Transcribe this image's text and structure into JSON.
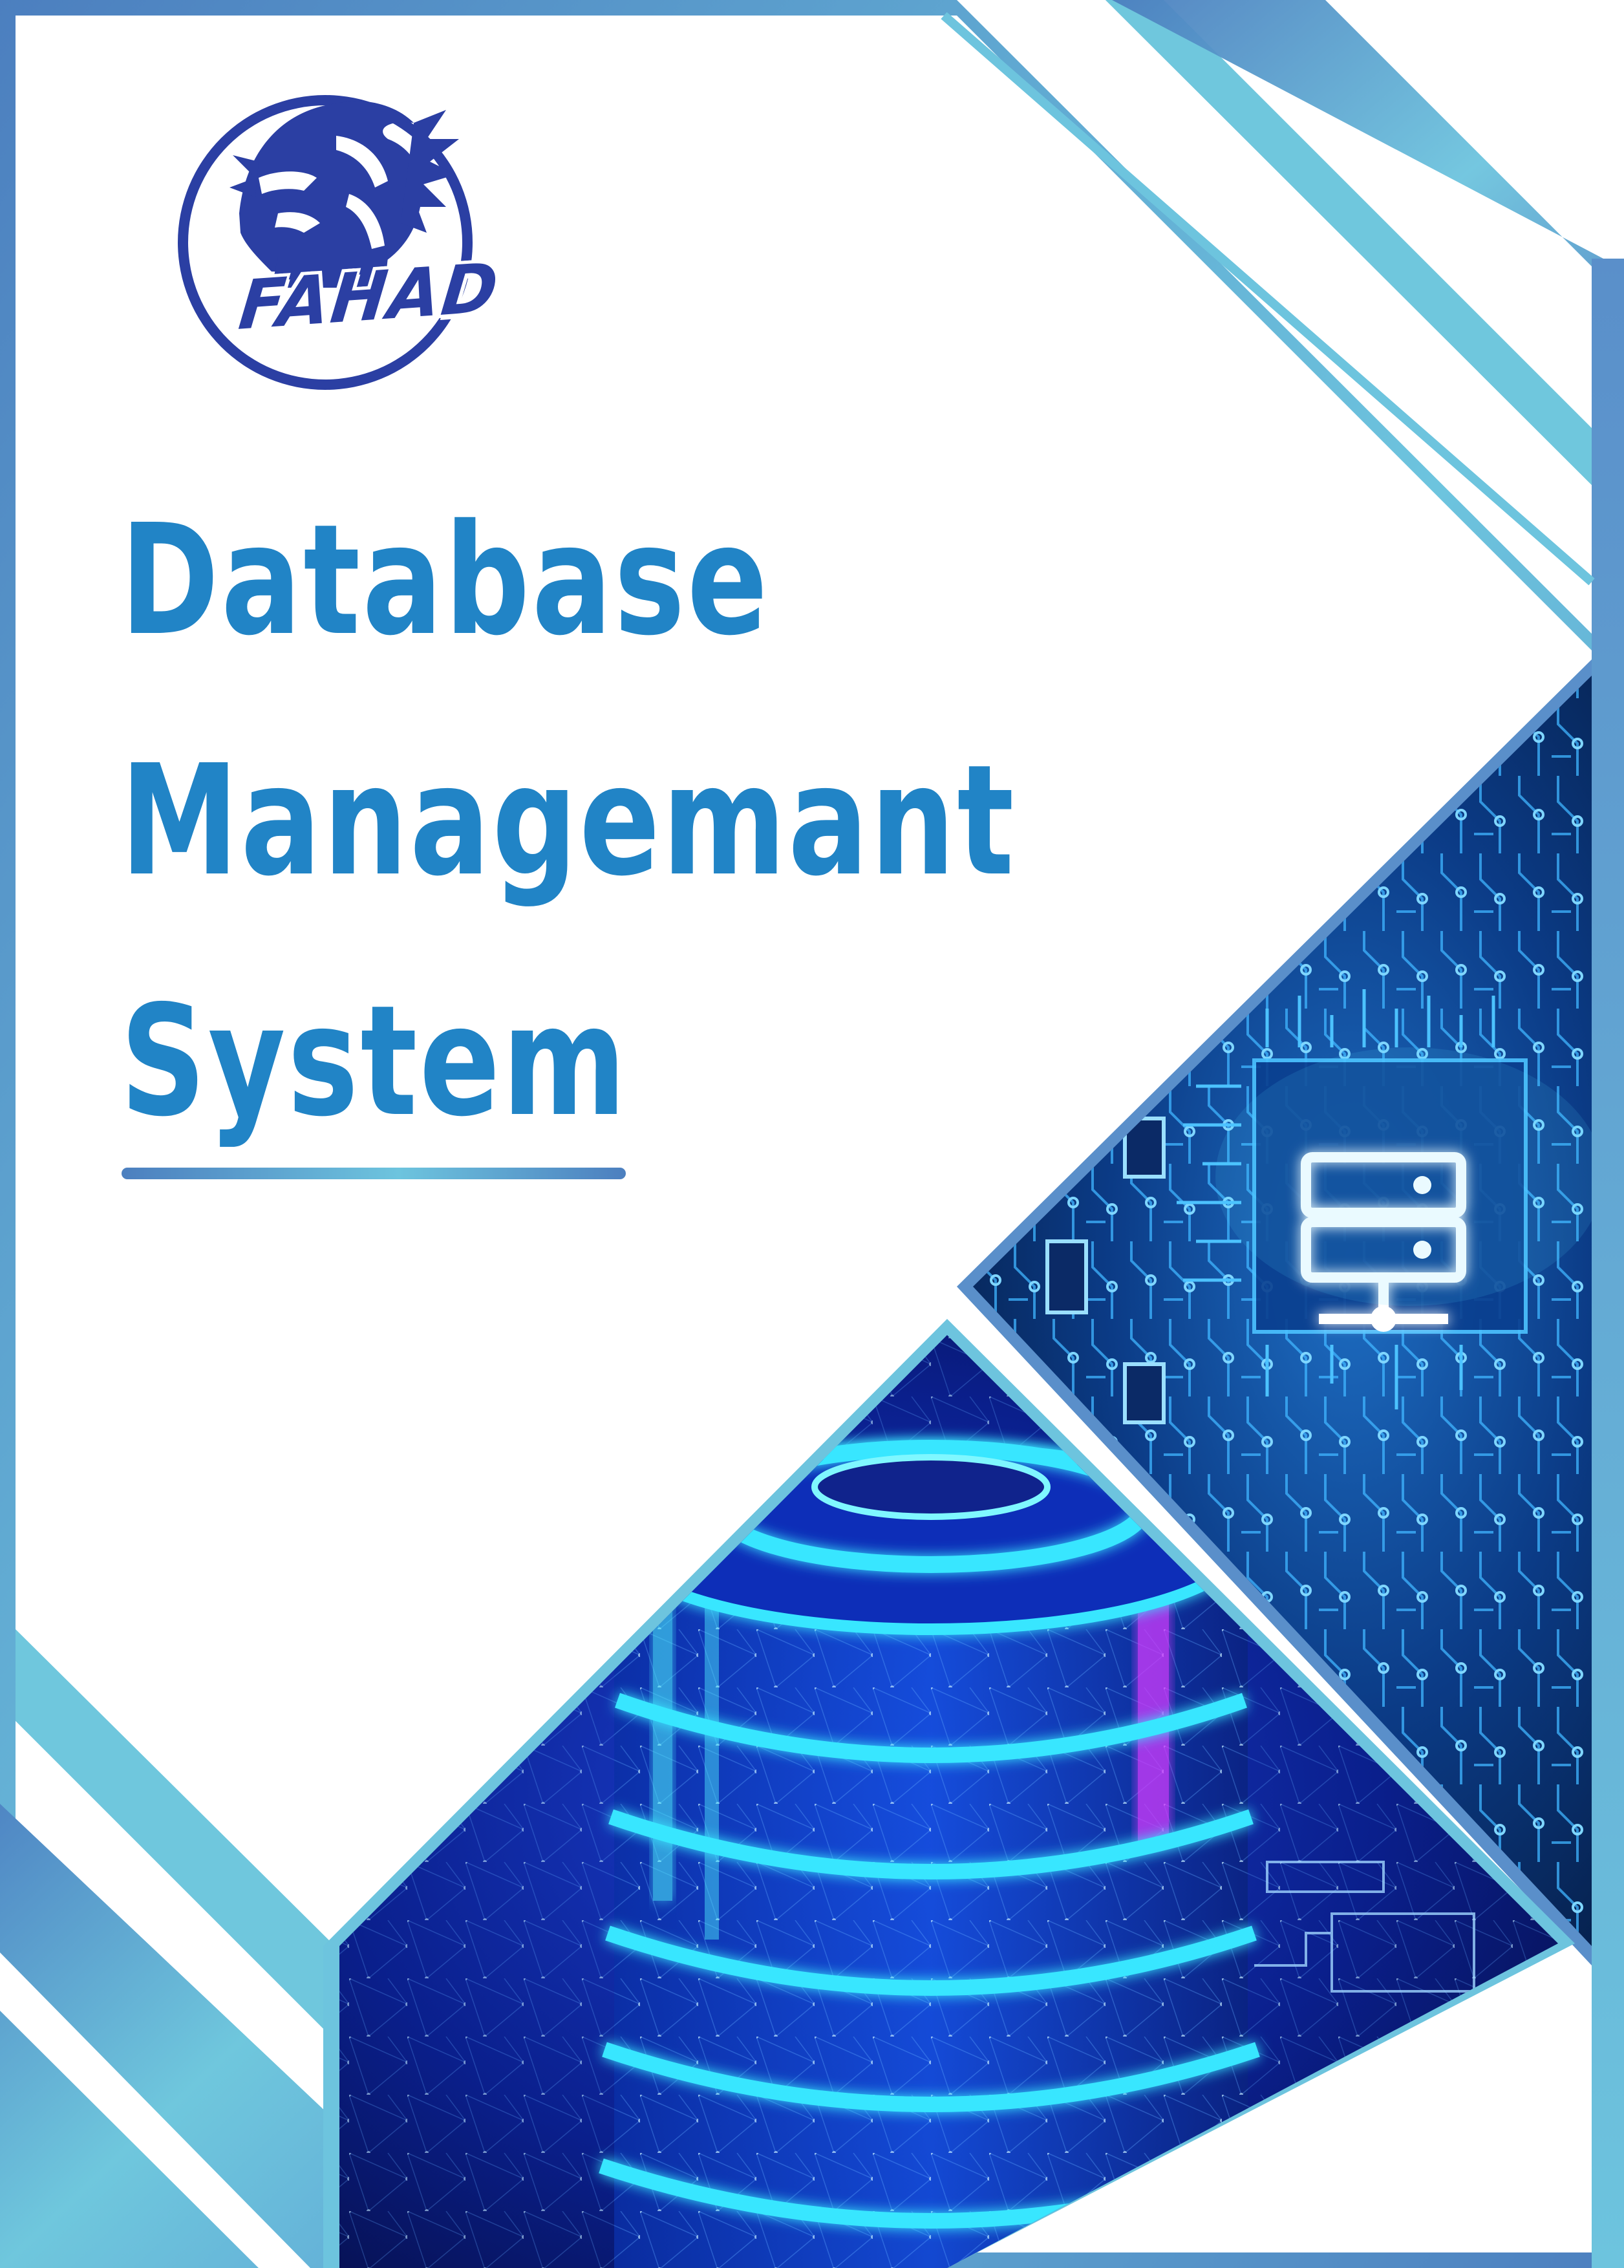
{
  "logo": {
    "text": "FAHAD",
    "icon": "lion-head-icon"
  },
  "title": {
    "line1": "Database",
    "line2": "Managemant",
    "line3": "System"
  },
  "images": {
    "server_circuit": "server-circuit-board-image",
    "database_cylinder": "glowing-database-cylinder-image"
  },
  "colors": {
    "title": "#2184c6",
    "frame_dark": "#4c7fbf",
    "frame_light": "#6dc4de",
    "logo": "#2b3fa3",
    "circuit_bg": "#061d45",
    "database_bg": "#0a1a78",
    "glow": "#39e6ff"
  }
}
